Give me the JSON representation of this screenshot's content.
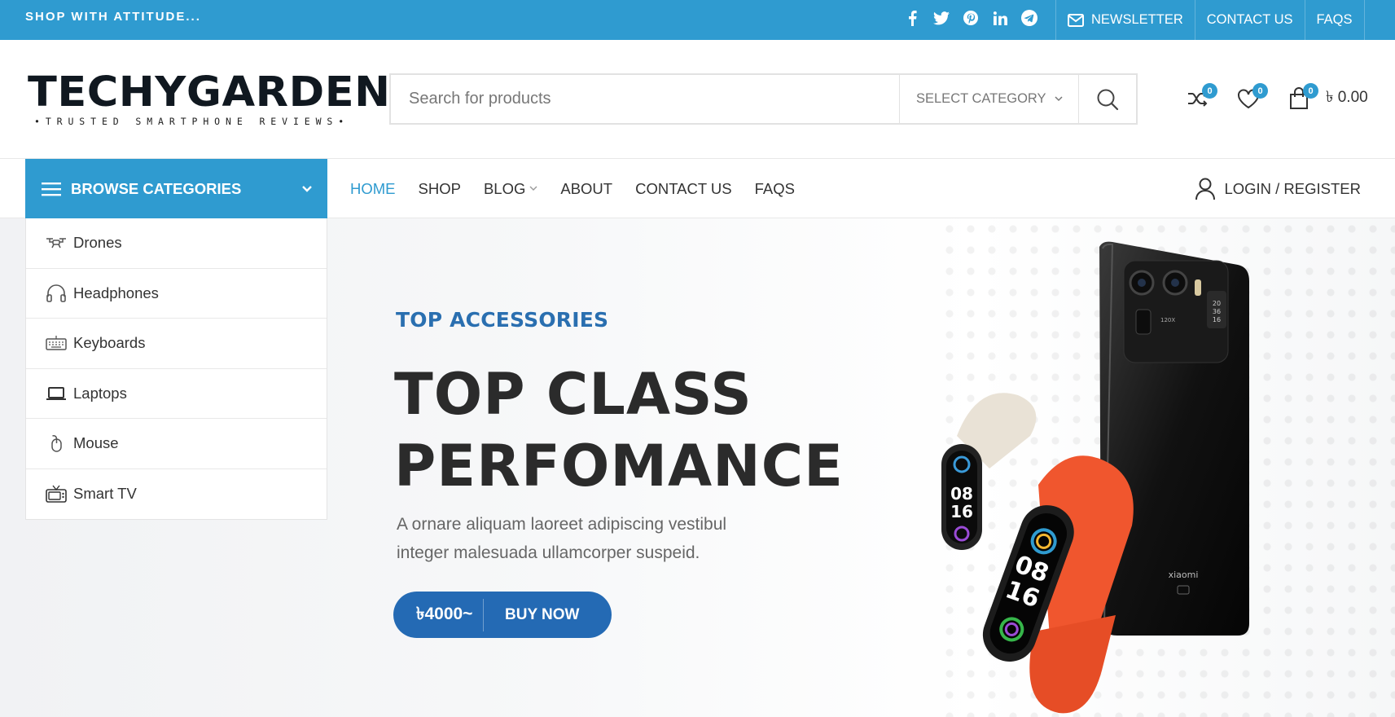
{
  "topbar": {
    "tagline": "SHOP WITH ATTITUDE...",
    "socials": [
      "facebook-icon",
      "twitter-icon",
      "pinterest-icon",
      "linkedin-icon",
      "telegram-icon"
    ],
    "links": {
      "newsletter": "NEWSLETTER",
      "contact": "CONTACT US",
      "faqs": "FAQS"
    },
    "bg_color": "#2f9bd0"
  },
  "header": {
    "logo_text": "TECHYGARDEN",
    "logo_tagline": "•TRUSTED SMARTPHONE REVIEWS•",
    "search": {
      "placeholder": "Search for products",
      "category": "SELECT CATEGORY"
    },
    "compare_count": "0",
    "wishlist_count": "0",
    "cart_count": "0",
    "cart_total": "৳ 0.00"
  },
  "nav": {
    "browse_label": "BROWSE CATEGORIES",
    "items": [
      "HOME",
      "SHOP",
      "BLOG",
      "ABOUT",
      "CONTACT US",
      "FAQS"
    ],
    "login_label": "LOGIN / REGISTER"
  },
  "categories": [
    {
      "label": "Drones",
      "icon": "drone-icon"
    },
    {
      "label": "Headphones",
      "icon": "headphones-icon"
    },
    {
      "label": "Keyboards",
      "icon": "keyboard-icon"
    },
    {
      "label": "Laptops",
      "icon": "laptop-icon"
    },
    {
      "label": "Mouse",
      "icon": "mouse-icon"
    },
    {
      "label": "Smart TV",
      "icon": "tv-icon"
    }
  ],
  "hero": {
    "kicker": "TOP ACCESSORIES",
    "title_line1": "TOP CLASS",
    "title_line2": "PERFOMANCE",
    "description_line1": "A ornare aliquam laoreet adipiscing vestibul",
    "description_line2": "integer malesuada ullamcorper suspeid.",
    "price": "৳4000~",
    "button_label": "BUY NOW",
    "phone_brand": "xiaomi",
    "watch_time_1": "08",
    "watch_time_2": "16"
  },
  "colors": {
    "accent": "#2f9bd0",
    "cta": "#246ab4",
    "kicker": "#2a6fb0",
    "strap": "#f0562e"
  }
}
